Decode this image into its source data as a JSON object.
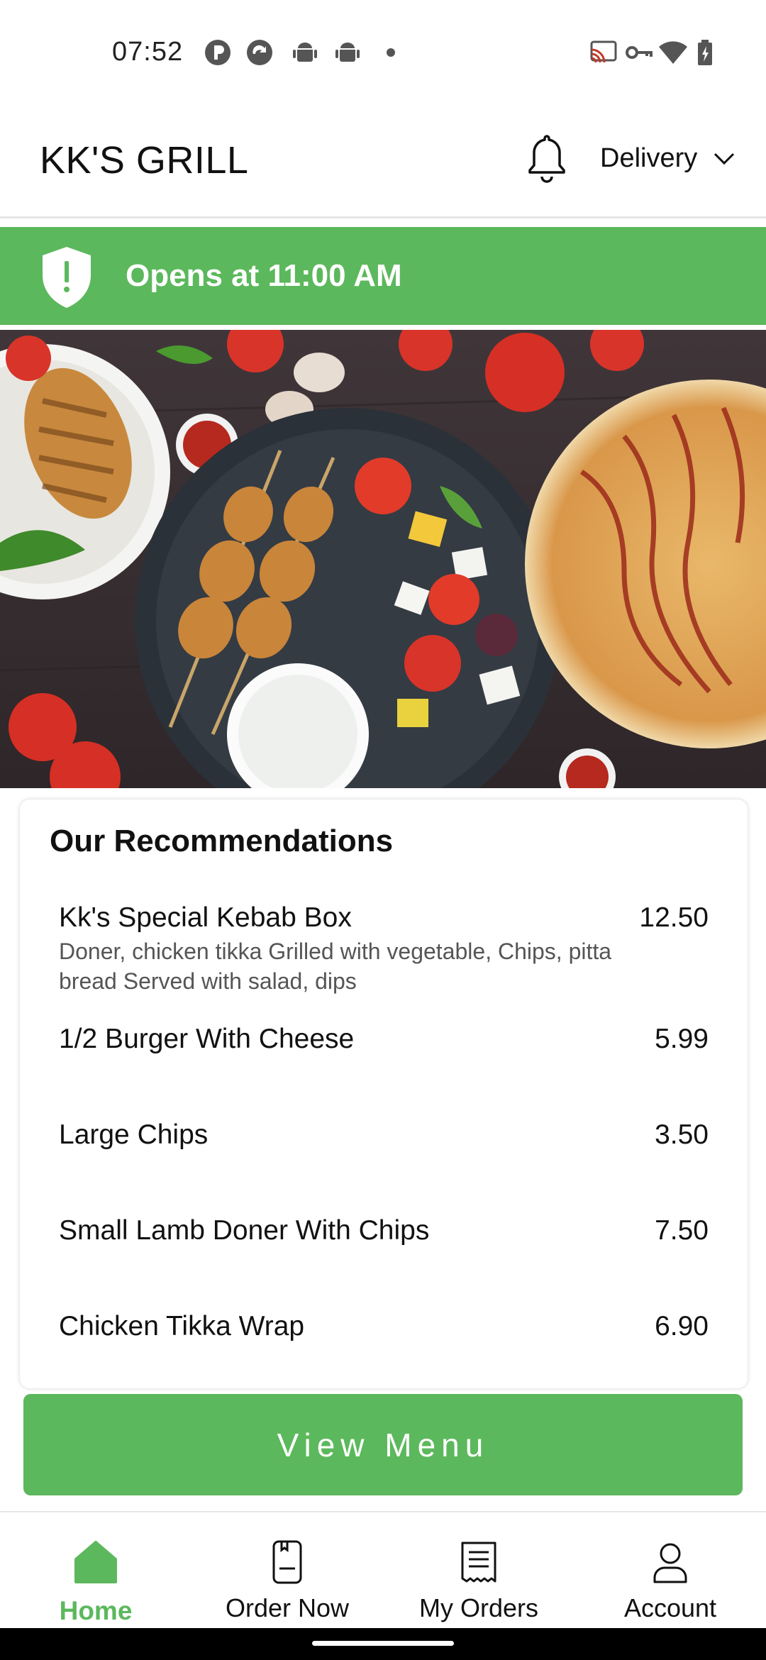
{
  "status_bar": {
    "time": "07:52"
  },
  "header": {
    "brand": "KK'S GRILL",
    "delivery_label": "Delivery",
    "icons": {
      "notifications": "bell-icon",
      "dropdown": "chevron-down-icon"
    }
  },
  "banner": {
    "text": "Opens at 11:00 AM",
    "icon": "shield-alert-icon",
    "color": "#5cb85c"
  },
  "hero": {
    "icon": "food-photo"
  },
  "recommendations": {
    "title": "Our Recommendations",
    "items": [
      {
        "name": "Kk's Special Kebab Box",
        "price": "12.50",
        "description": "Doner, chicken tikka Grilled with vegetable, Chips, pitta bread Served with salad, dips"
      },
      {
        "name": "1/2 Burger With Cheese",
        "price": "5.99"
      },
      {
        "name": "Large Chips",
        "price": "3.50"
      },
      {
        "name": "Small Lamb Doner With Chips",
        "price": "7.50"
      },
      {
        "name": "Chicken Tikka Wrap",
        "price": "6.90"
      }
    ]
  },
  "view_menu": {
    "label": "View Menu"
  },
  "bottom_nav": {
    "items": [
      {
        "label": "Home",
        "icon": "home-icon",
        "active": true
      },
      {
        "label": "Order Now",
        "icon": "order-icon",
        "active": false
      },
      {
        "label": "My Orders",
        "icon": "receipt-icon",
        "active": false
      },
      {
        "label": "Account",
        "icon": "user-icon",
        "active": false
      }
    ]
  },
  "colors": {
    "accent": "#5cb85c",
    "text": "#111111",
    "muted": "#555555"
  }
}
